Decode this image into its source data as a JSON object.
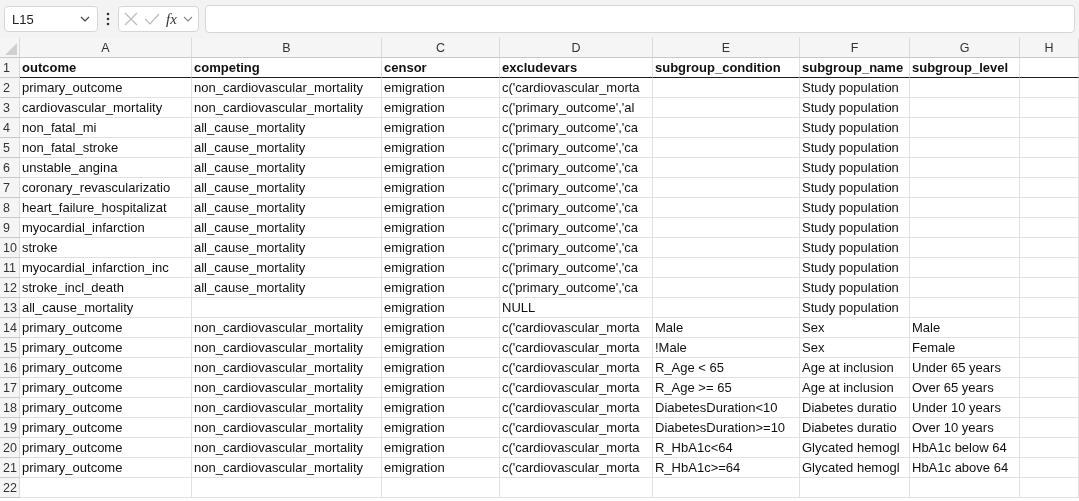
{
  "formula_bar": {
    "name_box": "L15",
    "function_label": "fx"
  },
  "columns": [
    "A",
    "B",
    "C",
    "D",
    "E",
    "F",
    "G",
    "H"
  ],
  "rows": [
    {
      "number": "1",
      "header": true,
      "cells": {
        "A": "outcome",
        "B": "competing",
        "C": "censor",
        "D": "excludevars",
        "E": "subgroup_condition",
        "F": "subgroup_name",
        "G": "subgroup_level"
      }
    },
    {
      "number": "2",
      "cells": {
        "A": "primary_outcome",
        "B": "non_cardiovascular_mortality",
        "C": "emigration",
        "D": "c('cardiovascular_morta",
        "F": "Study population"
      }
    },
    {
      "number": "3",
      "cells": {
        "A": "cardiovascular_mortality",
        "B": "non_cardiovascular_mortality",
        "C": "emigration",
        "D": "c('primary_outcome','al",
        "F": "Study population"
      }
    },
    {
      "number": "4",
      "cells": {
        "A": "non_fatal_mi",
        "B": "all_cause_mortality",
        "C": "emigration",
        "D": "c('primary_outcome','ca",
        "F": "Study population"
      }
    },
    {
      "number": "5",
      "cells": {
        "A": "non_fatal_stroke",
        "B": "all_cause_mortality",
        "C": "emigration",
        "D": "c('primary_outcome','ca",
        "F": "Study population"
      }
    },
    {
      "number": "6",
      "cells": {
        "A": "unstable_angina",
        "B": "all_cause_mortality",
        "C": "emigration",
        "D": "c('primary_outcome','ca",
        "F": "Study population"
      }
    },
    {
      "number": "7",
      "cells": {
        "A": "coronary_revascularizatio",
        "B": "all_cause_mortality",
        "C": "emigration",
        "D": "c('primary_outcome','ca",
        "F": "Study population"
      }
    },
    {
      "number": "8",
      "cells": {
        "A": "heart_failure_hospitalizat",
        "B": "all_cause_mortality",
        "C": "emigration",
        "D": "c('primary_outcome','ca",
        "F": "Study population"
      }
    },
    {
      "number": "9",
      "cells": {
        "A": "myocardial_infarction",
        "B": "all_cause_mortality",
        "C": "emigration",
        "D": "c('primary_outcome','ca",
        "F": "Study population"
      }
    },
    {
      "number": "10",
      "cells": {
        "A": "stroke",
        "B": "all_cause_mortality",
        "C": "emigration",
        "D": "c('primary_outcome','ca",
        "F": "Study population"
      }
    },
    {
      "number": "11",
      "cells": {
        "A": "myocardial_infarction_inc",
        "B": "all_cause_mortality",
        "C": "emigration",
        "D": "c('primary_outcome','ca",
        "F": "Study population"
      }
    },
    {
      "number": "12",
      "cells": {
        "A": "stroke_incl_death",
        "B": "all_cause_mortality",
        "C": "emigration",
        "D": "c('primary_outcome','ca",
        "F": "Study population"
      }
    },
    {
      "number": "13",
      "cells": {
        "A": "all_cause_mortality",
        "C": "emigration",
        "D": "NULL",
        "F": "Study population"
      }
    },
    {
      "number": "14",
      "cells": {
        "A": "primary_outcome",
        "B": "non_cardiovascular_mortality",
        "C": "emigration",
        "D": "c('cardiovascular_morta",
        "E": "Male",
        "F": "Sex",
        "G": "Male"
      }
    },
    {
      "number": "15",
      "cells": {
        "A": "primary_outcome",
        "B": "non_cardiovascular_mortality",
        "C": "emigration",
        "D": "c('cardiovascular_morta",
        "E": "!Male",
        "F": "Sex",
        "G": "Female"
      }
    },
    {
      "number": "16",
      "cells": {
        "A": "primary_outcome",
        "B": "non_cardiovascular_mortality",
        "C": "emigration",
        "D": "c('cardiovascular_morta",
        "E": "R_Age < 65",
        "F": "Age at inclusion",
        "G": "Under 65 years"
      }
    },
    {
      "number": "17",
      "cells": {
        "A": "primary_outcome",
        "B": "non_cardiovascular_mortality",
        "C": "emigration",
        "D": "c('cardiovascular_morta",
        "E": "R_Age >= 65",
        "F": "Age at inclusion",
        "G": "Over 65 years"
      }
    },
    {
      "number": "18",
      "cells": {
        "A": "primary_outcome",
        "B": "non_cardiovascular_mortality",
        "C": "emigration",
        "D": "c('cardiovascular_morta",
        "E": "DiabetesDuration<10",
        "F": "Diabetes duratio",
        "G": "Under 10 years"
      }
    },
    {
      "number": "19",
      "cells": {
        "A": "primary_outcome",
        "B": "non_cardiovascular_mortality",
        "C": "emigration",
        "D": "c('cardiovascular_morta",
        "E": "DiabetesDuration>=10",
        "F": "Diabetes duratio",
        "G": "Over 10 years"
      }
    },
    {
      "number": "20",
      "cells": {
        "A": "primary_outcome",
        "B": "non_cardiovascular_mortality",
        "C": "emigration",
        "D": "c('cardiovascular_morta",
        "E": "R_HbA1c<64",
        "F": "Glycated hemogl",
        "G": "HbA1c below 64"
      }
    },
    {
      "number": "21",
      "cells": {
        "A": "primary_outcome",
        "B": "non_cardiovascular_mortality",
        "C": "emigration",
        "D": "c('cardiovascular_morta",
        "E": "R_HbA1c>=64",
        "F": "Glycated hemogl",
        "G": "HbA1c above 64"
      }
    },
    {
      "number": "22"
    }
  ]
}
